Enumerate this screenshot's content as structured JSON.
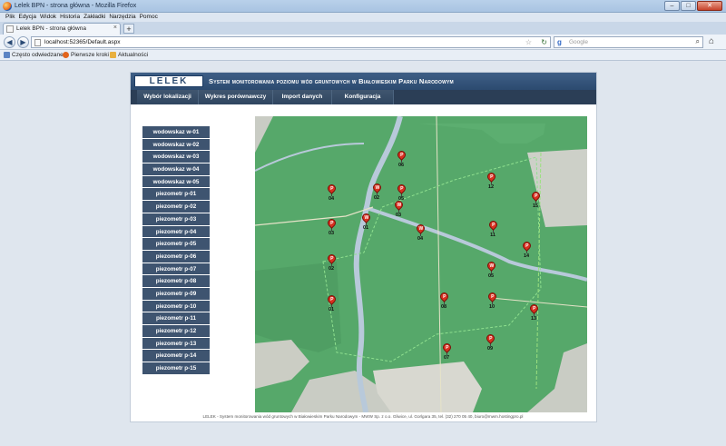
{
  "window": {
    "title": "Lelek BPN - strona główna - Mozilla Firefox",
    "buttons": [
      "–",
      "□",
      "✕"
    ]
  },
  "menu": [
    "Plik",
    "Edycja",
    "Widok",
    "Historia",
    "Zakładki",
    "Narzędzia",
    "Pomoc"
  ],
  "tab": {
    "label": "Lelek BPN - strona główna",
    "close": "×",
    "new": "+"
  },
  "nav": {
    "back": "◀",
    "forward": "▶",
    "url": "localhost:52365/Default.aspx",
    "star": "☆",
    "reload": "↻",
    "search_placeholder": "Google",
    "search_engine": "g",
    "search_icon": "⌕",
    "home": "⌂"
  },
  "bookmarks": [
    "Często odwiedzane",
    "Pierwsze kroki",
    "Aktualności"
  ],
  "site": {
    "logo": "LELEK",
    "title": "System monitorowania poziomu wód gruntowych w Białowieskim Parku Narodowym",
    "nav": [
      "Wybór lokalizacji",
      "Wykres porównawczy",
      "Import danych",
      "Konfiguracja"
    ],
    "sidebar": [
      "wodowskaz w-01",
      "wodowskaz w-02",
      "wodowskaz w-03",
      "wodowskaz w-04",
      "wodowskaz w-05",
      "piezometr p-01",
      "piezometr p-02",
      "piezometr p-03",
      "piezometr p-04",
      "piezometr p-05",
      "piezometr p-06",
      "piezometr p-07",
      "piezometr p-08",
      "piezometr p-09",
      "piezometr p-10",
      "piezometr p-11",
      "piezometr p-12",
      "piezometr p-13",
      "piezometr p-14",
      "piezometr p-15"
    ],
    "footer": "LELEK - System monitorowania wód gruntowych w Białowieskim Parku Narodowym - MWW Sp. z o.o. Gliwice, ul. Gorlgara 35, tel. (32) 270 05 40, biuro@mwm.hostingpro.pl"
  },
  "markers": [
    {
      "type": "P",
      "label": "06"
    },
    {
      "type": "P",
      "label": "12"
    },
    {
      "type": "P",
      "label": "04"
    },
    {
      "type": "W",
      "label": "02"
    },
    {
      "type": "P",
      "label": "05"
    },
    {
      "type": "P",
      "label": "15"
    },
    {
      "type": "W",
      "label": "03"
    },
    {
      "type": "W",
      "label": "01"
    },
    {
      "type": "P",
      "label": "03"
    },
    {
      "type": "W",
      "label": "04"
    },
    {
      "type": "P",
      "label": "11"
    },
    {
      "type": "P",
      "label": "14"
    },
    {
      "type": "P",
      "label": "02"
    },
    {
      "type": "W",
      "label": "05"
    },
    {
      "type": "P",
      "label": "01"
    },
    {
      "type": "P",
      "label": "08"
    },
    {
      "type": "P",
      "label": "10"
    },
    {
      "type": "P",
      "label": "13"
    },
    {
      "type": "P",
      "label": "09"
    },
    {
      "type": "P",
      "label": "07"
    }
  ]
}
